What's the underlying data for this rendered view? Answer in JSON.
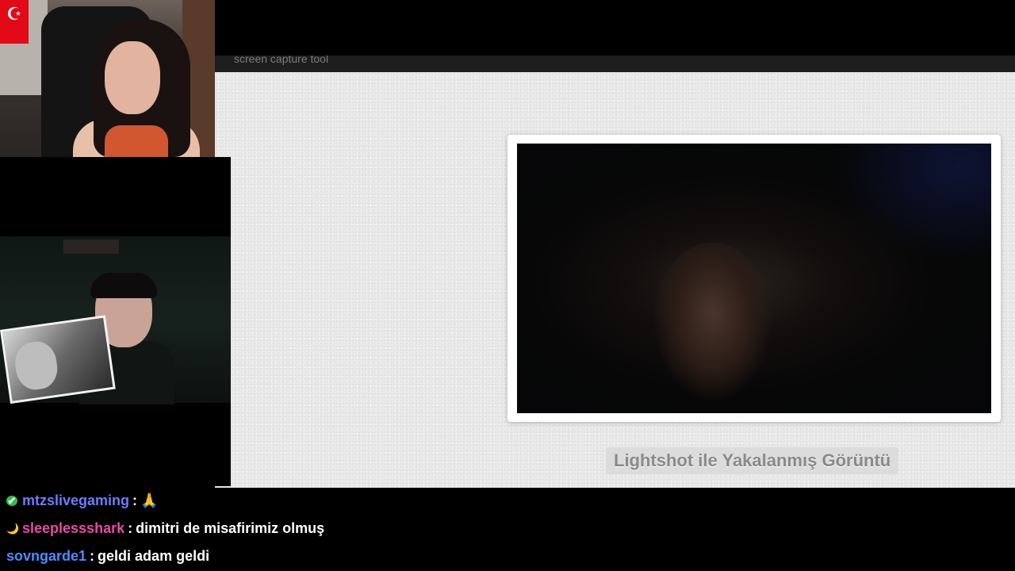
{
  "browser": {
    "subbar_text": "screen capture tool"
  },
  "lightshot": {
    "caption": "Lightshot ile Yakalanmış Görüntü"
  },
  "overlay": {
    "flag_symbol": "☪"
  },
  "chat": {
    "messages": [
      {
        "badge": "✔",
        "badge_icon": "verified-check-icon",
        "user": "mtzslivegaming",
        "user_color": "#6b7cff",
        "separator": ":",
        "text": "🙏"
      },
      {
        "badge": "🌙",
        "badge_icon": "crescent-moon-icon",
        "user": "sleeplessshark",
        "user_color": "#e84aa7",
        "separator": ":",
        "text": "dimitri de misafirimiz olmuş"
      },
      {
        "badge": "",
        "badge_icon": "",
        "user": "sovngarde1",
        "user_color": "#4a8cff",
        "separator": ":",
        "text": "geldi adam geldi"
      }
    ]
  }
}
